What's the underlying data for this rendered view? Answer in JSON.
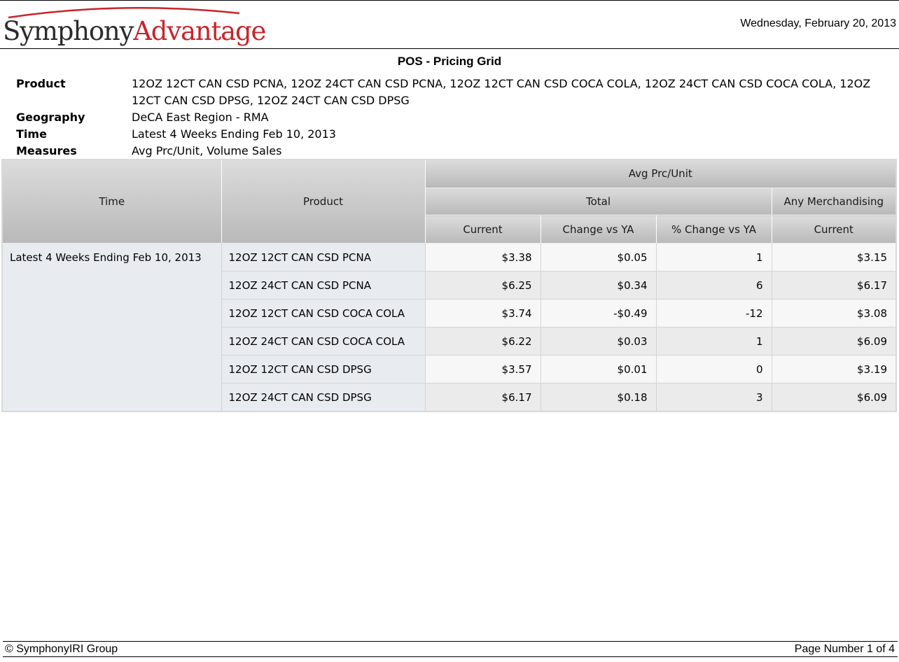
{
  "header": {
    "brand_part1": "Symphony",
    "brand_part2": "Advantage",
    "date": "Wednesday, February 20, 2013"
  },
  "title": "POS - Pricing Grid",
  "criteria": [
    {
      "label": "Product",
      "value": "12OZ 12CT CAN CSD PCNA, 12OZ 24CT CAN CSD PCNA, 12OZ 12CT CAN CSD COCA COLA, 12OZ 24CT CAN CSD COCA COLA, 12OZ 12CT CAN CSD DPSG, 12OZ 24CT CAN CSD DPSG"
    },
    {
      "label": "Geography",
      "value": "DeCA East Region - RMA"
    },
    {
      "label": "Time",
      "value": "Latest 4 Weeks Ending Feb 10, 2013"
    },
    {
      "label": "Measures",
      "value": "Avg Prc/Unit, Volume Sales"
    }
  ],
  "grid": {
    "headers": {
      "time": "Time",
      "product": "Product",
      "measure": "Avg Prc/Unit",
      "group_total": "Total",
      "group_merch": "Any Merchandising",
      "col_current": "Current",
      "col_change": "Change vs YA",
      "col_pct_change": "% Change vs YA",
      "col_merch_current": "Current"
    },
    "time_value": "Latest 4 Weeks Ending Feb 10, 2013",
    "rows": [
      {
        "product": "12OZ 12CT CAN CSD PCNA",
        "current": "$3.38",
        "change": "$0.05",
        "pct_change": "1",
        "merch_current": "$3.15"
      },
      {
        "product": "12OZ 24CT CAN CSD PCNA",
        "current": "$6.25",
        "change": "$0.34",
        "pct_change": "6",
        "merch_current": "$6.17"
      },
      {
        "product": "12OZ 12CT CAN CSD COCA COLA",
        "current": "$3.74",
        "change": "-$0.49",
        "pct_change": "-12",
        "merch_current": "$3.08"
      },
      {
        "product": "12OZ 24CT CAN CSD COCA COLA",
        "current": "$6.22",
        "change": "$0.03",
        "pct_change": "1",
        "merch_current": "$6.09"
      },
      {
        "product": "12OZ 12CT CAN CSD DPSG",
        "current": "$3.57",
        "change": "$0.01",
        "pct_change": "0",
        "merch_current": "$3.19"
      },
      {
        "product": "12OZ 24CT CAN CSD DPSG",
        "current": "$6.17",
        "change": "$0.18",
        "pct_change": "3",
        "merch_current": "$6.09"
      }
    ]
  },
  "footer": {
    "copyright": "© SymphonyIRI Group",
    "page": "Page Number 1 of 4"
  },
  "colors": {
    "brand_red": "#c8242c",
    "header_gray": "#c8c8c8",
    "row_label_bg": "#e8ecf1"
  }
}
